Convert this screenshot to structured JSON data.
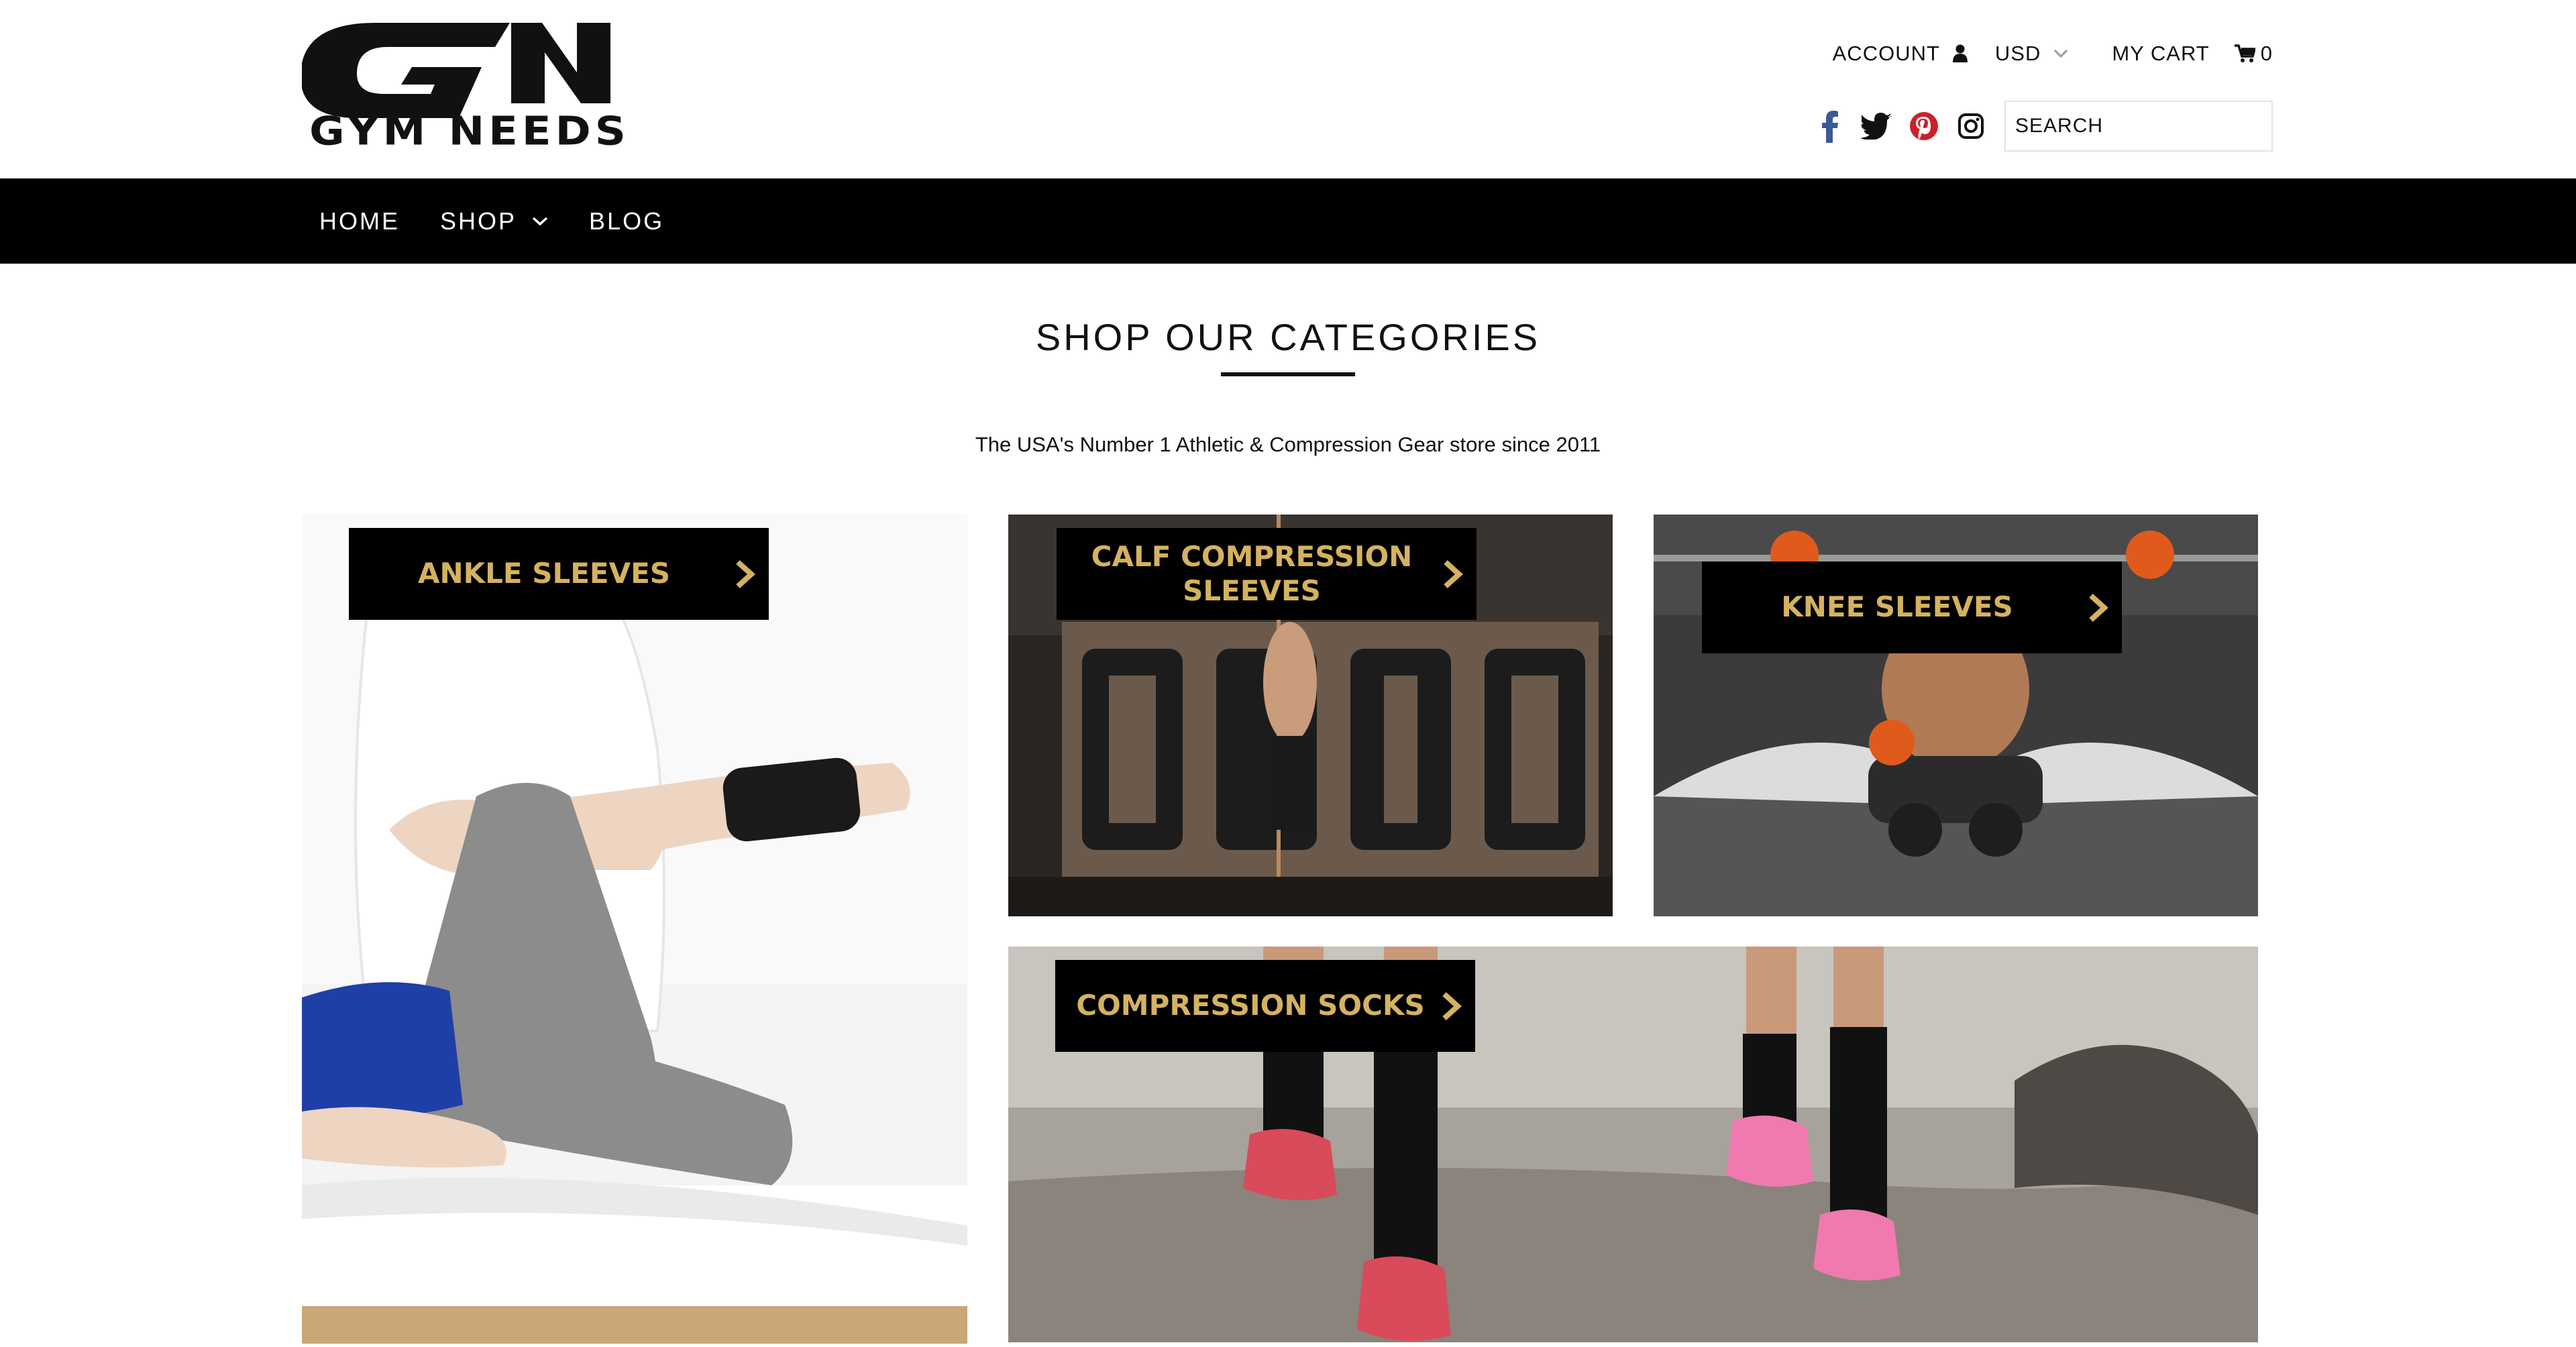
{
  "brand": {
    "logo_monogram": "GN",
    "logo_wordmark": "GYM NEEDS"
  },
  "header": {
    "account_label": "ACCOUNT",
    "account_icon": "user-icon",
    "currency_label": "USD",
    "currency_icon": "chevron-down-icon",
    "cart_label": "MY CART",
    "cart_icon": "cart-icon",
    "cart_count": "0",
    "social": [
      "facebook-icon",
      "twitter-icon",
      "pinterest-icon",
      "instagram-icon"
    ],
    "search_placeholder": "SEARCH"
  },
  "nav": {
    "items": [
      {
        "label": "HOME"
      },
      {
        "label": "SHOP",
        "icon": "chevron-down-icon"
      },
      {
        "label": "BLOG"
      }
    ]
  },
  "categories": {
    "heading": "SHOP OUR CATEGORIES",
    "tagline": "The USA's Number 1 Athletic & Compression Gear store since 2011",
    "tiles": [
      {
        "label": "ANKLE SLEEVES",
        "icon": "chevron-right-icon"
      },
      {
        "label": "CALF COMPRESSION SLEEVES",
        "icon": "chevron-right-icon"
      },
      {
        "label": "KNEE SLEEVES",
        "icon": "chevron-right-icon"
      },
      {
        "label": "COMPRESSION SOCKS",
        "icon": "chevron-right-icon"
      }
    ]
  },
  "colors": {
    "nav_background": "#000000",
    "label_background": "#000000",
    "label_text": "#d4b25f",
    "facebook": "#3b5998",
    "pinterest": "#cb2027"
  }
}
